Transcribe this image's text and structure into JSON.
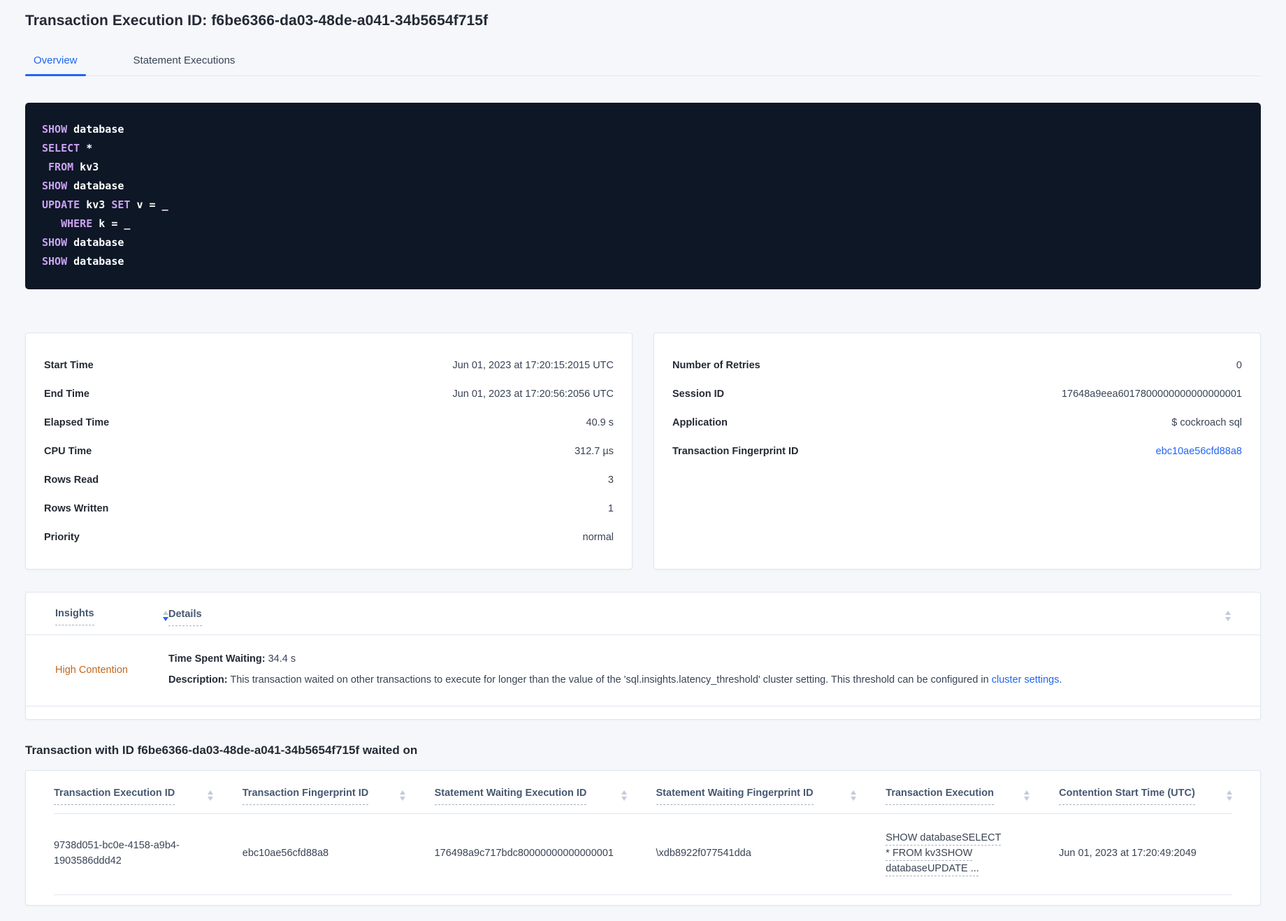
{
  "colors": {
    "accent_blue": "#2166f2",
    "high_contention_orange": "#c2671d",
    "code_background": "#0e1726",
    "code_keyword": "#c8a2f0",
    "page_background": "#f5f7fa"
  },
  "page": {
    "title": "Transaction Execution ID: f6be6366-da03-48de-a041-34b5654f715f"
  },
  "tabs": [
    {
      "label": "Overview",
      "active": true
    },
    {
      "label": "Statement Executions",
      "active": false
    }
  ],
  "sql": {
    "lines": [
      {
        "tokens": [
          {
            "t": "SHOW"
          },
          {
            "t": " database"
          }
        ]
      },
      {
        "tokens": [
          {
            "t": "SELECT"
          },
          {
            "t": " *"
          }
        ]
      },
      {
        "tokens": [
          {
            "t": " "
          },
          {
            "t": "FROM"
          },
          {
            "t": " kv3"
          }
        ]
      },
      {
        "tokens": [
          {
            "t": "SHOW"
          },
          {
            "t": " database"
          }
        ]
      },
      {
        "tokens": [
          {
            "t": "UPDATE"
          },
          {
            "t": " kv3 "
          },
          {
            "t": "SET"
          },
          {
            "t": " v = _"
          }
        ]
      },
      {
        "tokens": [
          {
            "t": "   "
          },
          {
            "t": "WHERE"
          },
          {
            "t": " k = _"
          }
        ]
      },
      {
        "tokens": [
          {
            "t": "SHOW"
          },
          {
            "t": " database"
          }
        ]
      },
      {
        "tokens": [
          {
            "t": "SHOW"
          },
          {
            "t": " database"
          }
        ]
      }
    ]
  },
  "summary": {
    "left": {
      "rows": [
        {
          "label": "Start Time",
          "value": "Jun 01, 2023 at 17:20:15:2015 UTC"
        },
        {
          "label": "End Time",
          "value": "Jun 01, 2023 at 17:20:56:2056 UTC"
        },
        {
          "label": "Elapsed Time",
          "value": "40.9 s"
        },
        {
          "label": "CPU Time",
          "value": "312.7 µs"
        },
        {
          "label": "Rows Read",
          "value": "3"
        },
        {
          "label": "Rows Written",
          "value": "1"
        },
        {
          "label": "Priority",
          "value": "normal"
        }
      ]
    },
    "right": {
      "rows": [
        {
          "label": "Number of Retries",
          "value": "0"
        },
        {
          "label": "Session ID",
          "value": "17648a9eea6017800000000000000001"
        },
        {
          "label": "Application",
          "value": "$ cockroach sql"
        },
        {
          "label": "Transaction Fingerprint ID",
          "value": "ebc10ae56cfd88a8"
        }
      ]
    }
  },
  "insights": {
    "columns": [
      "Insights",
      "Details"
    ],
    "row": {
      "insight": "High Contention",
      "waiting_label": "Time Spent Waiting:",
      "waiting_value": " 34.4 s",
      "description_label": "Description:",
      "description_text": " This transaction waited on other transactions to execute for longer than the value of the 'sql.insights.latency_threshold' cluster setting. This threshold can be configured in ",
      "link_text": "cluster settings",
      "period": "."
    }
  },
  "waited_on": {
    "heading": "Transaction with ID f6be6366-da03-48de-a041-34b5654f715f waited on",
    "columns": [
      "Transaction Execution ID",
      "Transaction Fingerprint ID",
      "Statement Waiting Execution ID",
      "Statement Waiting Fingerprint ID",
      "Transaction Execution",
      "Contention Start Time (UTC)"
    ],
    "row": {
      "transaction_execution_id": "9738d051-bc0e-4158-a9b4-1903586ddd42",
      "transaction_fingerprint_id": "ebc10ae56cfd88a8",
      "statement_waiting_execution_id": "176498a9c717bdc80000000000000001",
      "statement_waiting_fingerprint_id": "\\xdb8922f077541dda",
      "transaction_execution": "SHOW databaseSELECT * FROM kv3SHOW databaseUPDATE ...",
      "contention_start_time": "Jun 01, 2023 at 17:20:49:2049"
    }
  }
}
